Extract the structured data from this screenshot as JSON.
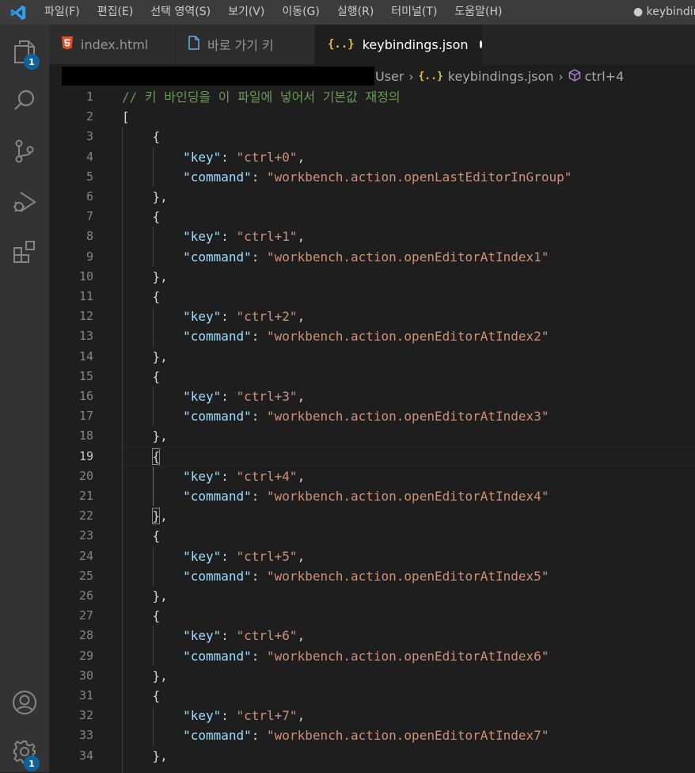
{
  "menu": {
    "items": [
      "파일(F)",
      "편집(E)",
      "선택 영역(S)",
      "보기(V)",
      "이동(G)",
      "실행(R)",
      "터미널(T)",
      "도움말(H)"
    ]
  },
  "window_title": "● keybindin",
  "activity": {
    "explorer_badge": "1",
    "settings_badge": "1"
  },
  "tabs": [
    {
      "label": "index.html",
      "icon": "html5-icon"
    },
    {
      "label": "바로 가기 키",
      "icon": "file-icon"
    },
    {
      "label": "keybindings.json",
      "icon": "json-braces-icon",
      "dirty": true
    }
  ],
  "breadcrumb": {
    "user": "User",
    "file": "keybindings.json",
    "symbol": "ctrl+4"
  },
  "editor": {
    "comment": "// 키 바인딩을 이 파일에 넣어서 기본값 재정의",
    "current_line": 19,
    "bindings": [
      {
        "key": "ctrl+0",
        "command": "workbench.action.openLastEditorInGroup"
      },
      {
        "key": "ctrl+1",
        "command": "workbench.action.openEditorAtIndex1"
      },
      {
        "key": "ctrl+2",
        "command": "workbench.action.openEditorAtIndex2"
      },
      {
        "key": "ctrl+3",
        "command": "workbench.action.openEditorAtIndex3"
      },
      {
        "key": "ctrl+4",
        "command": "workbench.action.openEditorAtIndex4"
      },
      {
        "key": "ctrl+5",
        "command": "workbench.action.openEditorAtIndex5"
      },
      {
        "key": "ctrl+6",
        "command": "workbench.action.openEditorAtIndex6"
      },
      {
        "key": "ctrl+7",
        "command": "workbench.action.openEditorAtIndex7"
      }
    ]
  },
  "colors": {
    "accent": "#0e639c",
    "comment": "#6a9955",
    "json_key": "#9cdcfe",
    "string": "#ce9178"
  }
}
